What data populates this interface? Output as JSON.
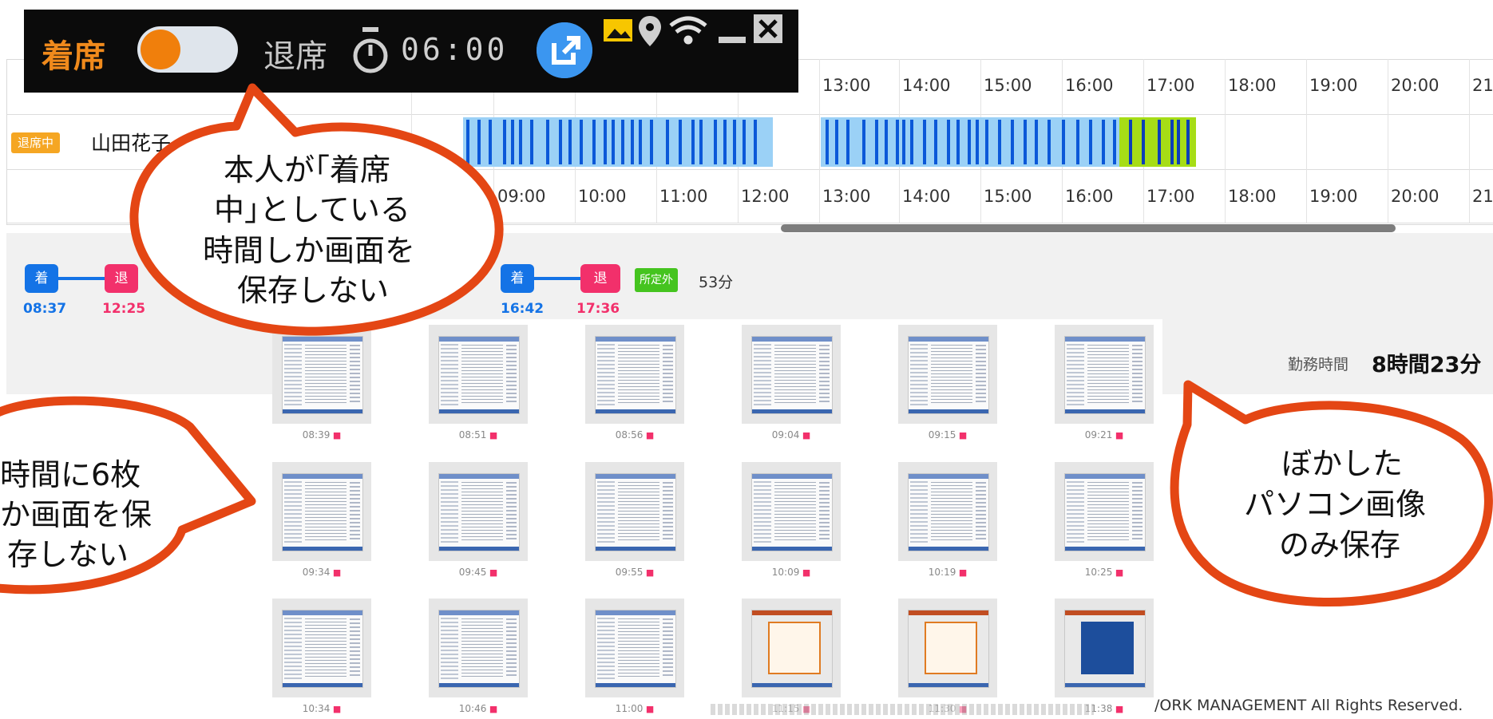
{
  "toolbar": {
    "seated_label": "着席",
    "away_label": "退席",
    "timer": "06:00",
    "icons": [
      "timer-icon",
      "external-link-icon",
      "image-icon",
      "location-icon",
      "wifi-icon",
      "minimize-icon",
      "close-icon"
    ],
    "accent_color": "#f08a1c"
  },
  "timeline": {
    "header_hours": [
      "13:00",
      "14:00",
      "15:00",
      "16:00",
      "17:00",
      "18:00",
      "19:00",
      "20:00",
      "21"
    ],
    "footer_hours": [
      "09:00",
      "10:00",
      "11:00",
      "12:00",
      "13:00",
      "14:00",
      "15:00",
      "16:00",
      "17:00",
      "18:00",
      "19:00",
      "20:00",
      "21"
    ],
    "user": {
      "status": "退席中",
      "name": "山田花子"
    }
  },
  "summary": {
    "session1": {
      "in_label": "着",
      "out_label": "退",
      "in_time": "08:37",
      "out_time": "12:25"
    },
    "session2": {
      "in_label": "着",
      "out_label": "退",
      "in_time": "16:42",
      "out_time": "17:36",
      "extra_tag": "所定外",
      "extra_value": "53分"
    },
    "work_label": "勤務時間",
    "work_value": "8時間23分"
  },
  "thumbnails": {
    "row1": [
      "08:39",
      "08:51",
      "08:56",
      "09:04",
      "09:15",
      "09:21"
    ],
    "row2": [
      "09:34",
      "09:45",
      "09:55",
      "10:09",
      "10:19",
      "10:25"
    ],
    "row3": [
      "10:34",
      "10:46",
      "11:00",
      "11:15",
      "11:30",
      "11:38"
    ]
  },
  "callouts": {
    "top": [
      "本人が｢着席",
      "中｣としている",
      "時間しか画面を",
      "保存しない"
    ],
    "left": [
      "時間に6枚",
      "か画面を保",
      "存しない"
    ],
    "right": [
      "ぼかした",
      "パソコン画像",
      "のみ保存"
    ]
  },
  "footer": "/ORK MANAGEMENT All Rights Reserved."
}
